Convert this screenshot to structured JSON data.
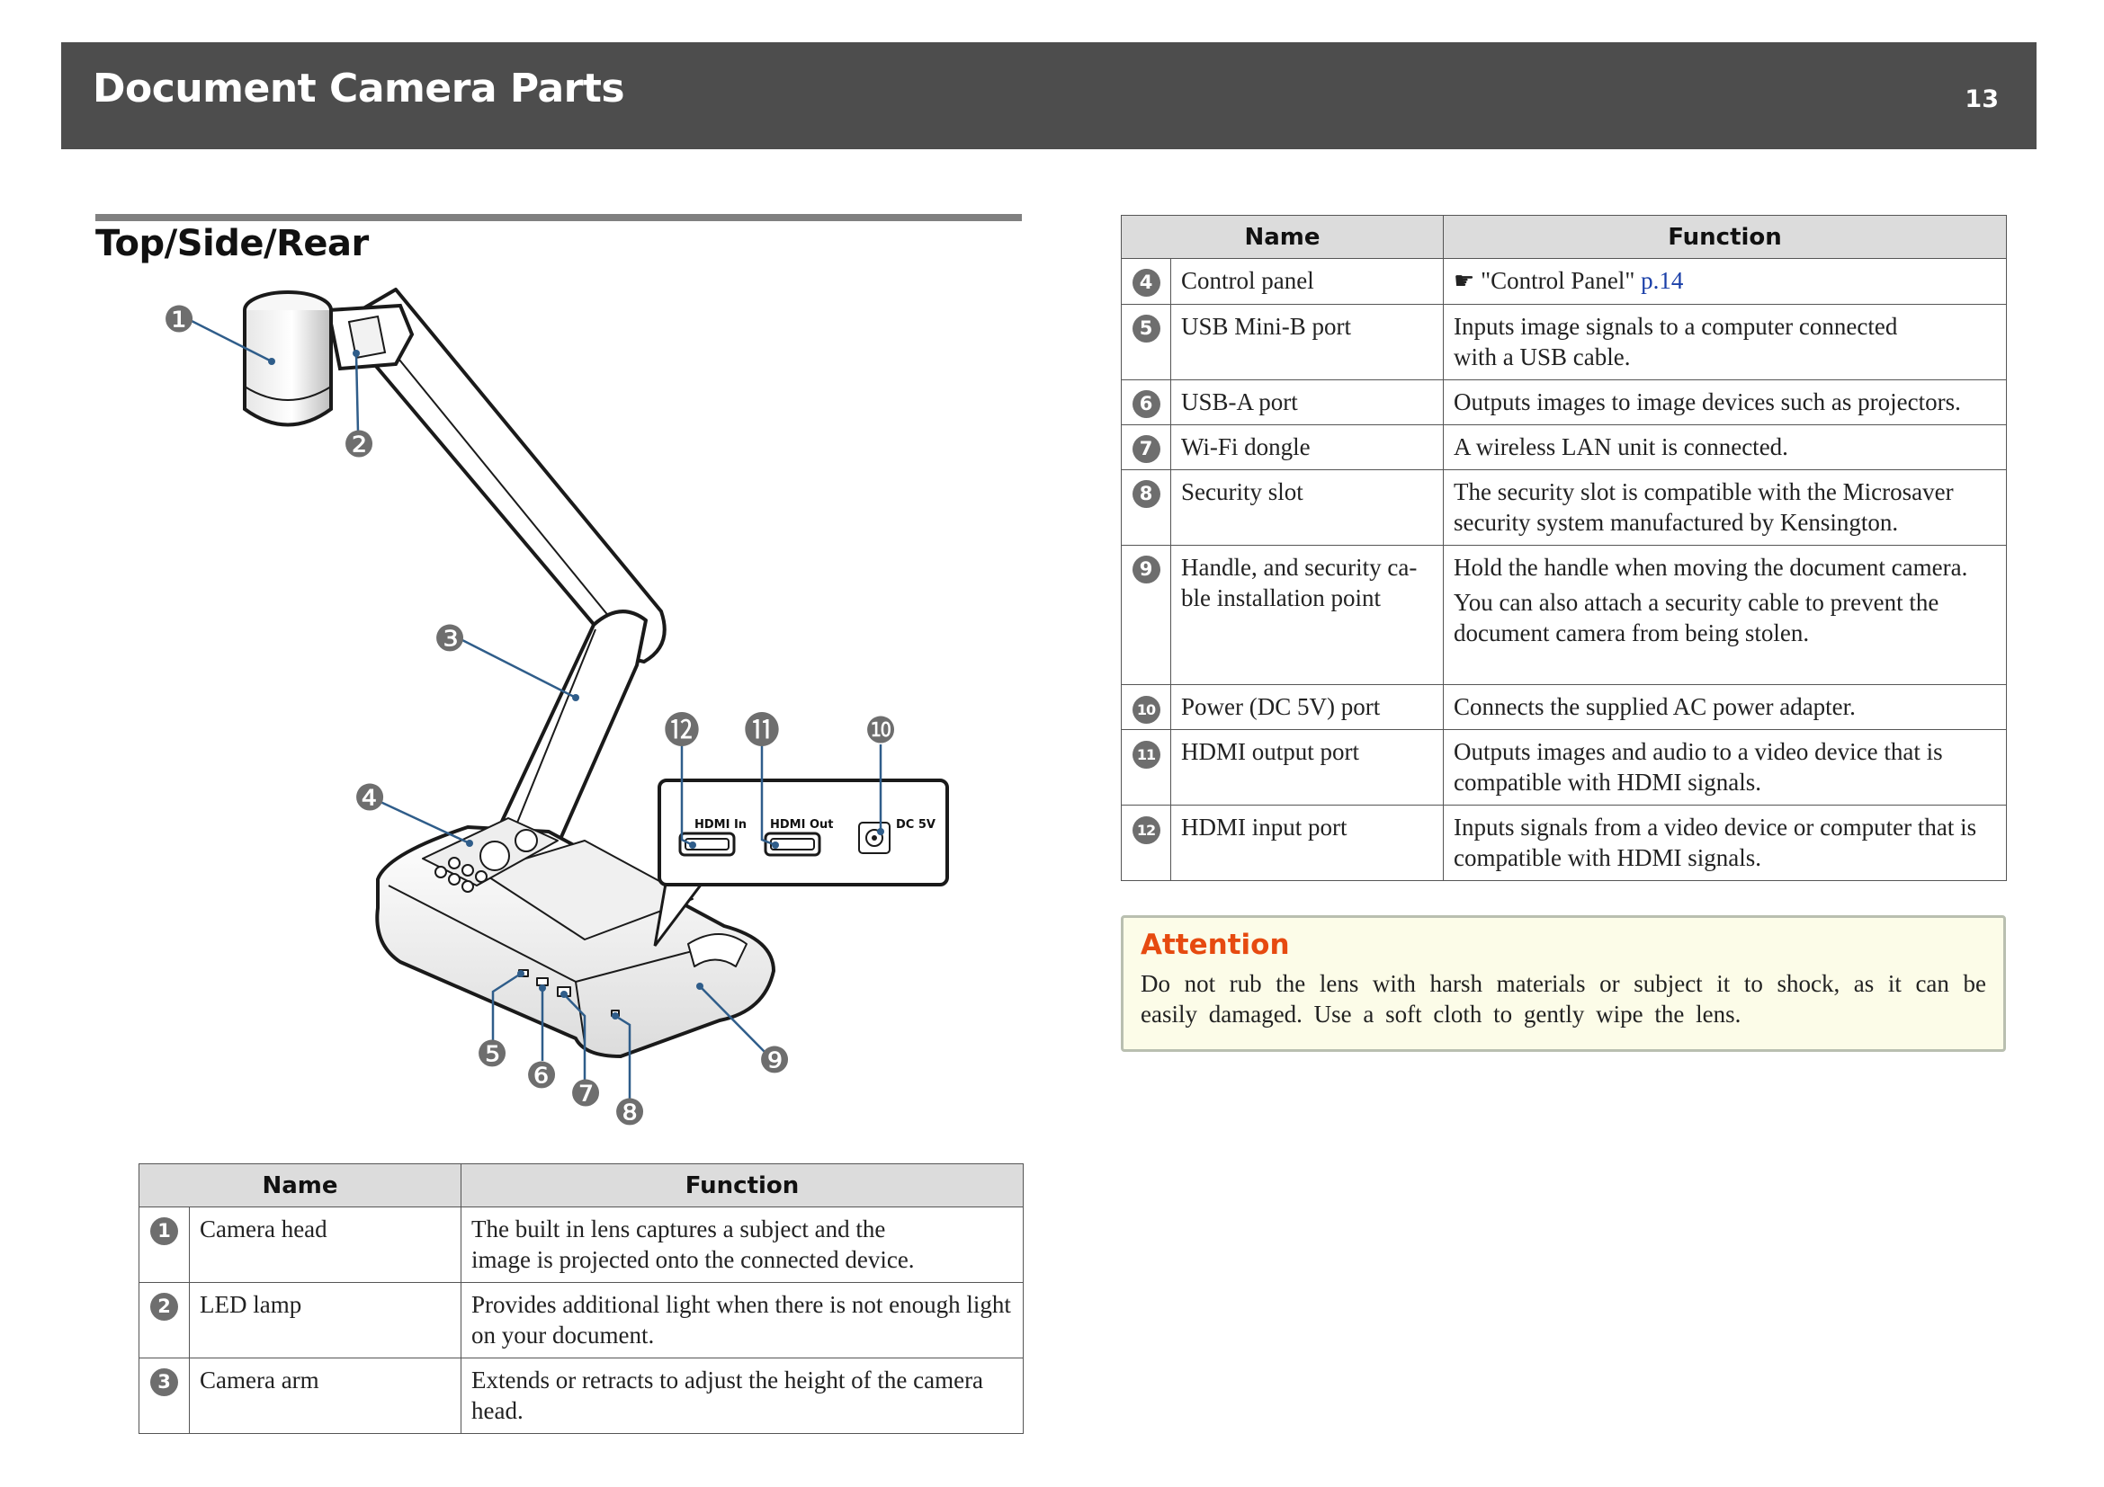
{
  "header": {
    "title": "Document Camera Parts",
    "page_number": "13"
  },
  "section": {
    "title": "Top/Side/Rear"
  },
  "figure": {
    "port_labels": {
      "hdmi_in": "HDMI In",
      "hdmi_out": "HDMI Out",
      "dc": "DC 5V"
    },
    "callouts": [
      "❶",
      "❷",
      "❸",
      "❹",
      "❺",
      "❻",
      "❼",
      "❽",
      "❾",
      "❿",
      "⓫",
      "⓬"
    ]
  },
  "table_left": {
    "headers": [
      "Name",
      "Function"
    ],
    "rows": [
      {
        "num": "1",
        "name": "Camera head",
        "function_lines": [
          "The built in lens captures a subject and the",
          "image is projected onto the connected device."
        ]
      },
      {
        "num": "2",
        "name": "LED lamp",
        "function": "Provides additional light when there is not enough light on your document."
      },
      {
        "num": "3",
        "name": "Camera arm",
        "function": "Extends or retracts to adjust the height of the camera head."
      }
    ]
  },
  "table_right": {
    "headers": [
      "Name",
      "Function"
    ],
    "rows": [
      {
        "num": "4",
        "name": "Control panel",
        "ref_icon": "☛",
        "ref_text": "\"Control Panel\" ",
        "ref_link": "p.14"
      },
      {
        "num": "5",
        "name": "USB Mini-B port",
        "function_lines": [
          "Inputs image signals to a computer connected",
          "with a USB cable."
        ]
      },
      {
        "num": "6",
        "name": "USB-A port",
        "function": "Outputs images to image devices such as projectors."
      },
      {
        "num": "7",
        "name": "Wi-Fi dongle",
        "function": "A wireless LAN unit is connected."
      },
      {
        "num": "8",
        "name": "Security slot",
        "function": "The security slot is compatible with the Microsaver security system manufactured by Kensington."
      },
      {
        "num": "9",
        "name_lines": [
          "Handle, and security ca-",
          "ble installation point"
        ],
        "function_paragraphs": [
          "Hold the handle when moving the document camera.",
          "You can also attach a security cable to prevent the document camera from being stolen."
        ]
      },
      {
        "num": "10",
        "name": "Power (DC 5V) port",
        "function": "Connects the supplied AC power adapter."
      },
      {
        "num": "11",
        "name": "HDMI output port",
        "function": "Outputs images and audio to a video device that is compatible with HDMI signals."
      },
      {
        "num": "12",
        "name": "HDMI input port",
        "function": "Inputs signals from a video device or computer that is compatible with HDMI signals."
      }
    ]
  },
  "attention": {
    "title": "Attention",
    "text": "Do not rub the lens with harsh materials or subject it to shock, as it can be easily damaged. Use a soft cloth to gently wipe the lens."
  }
}
